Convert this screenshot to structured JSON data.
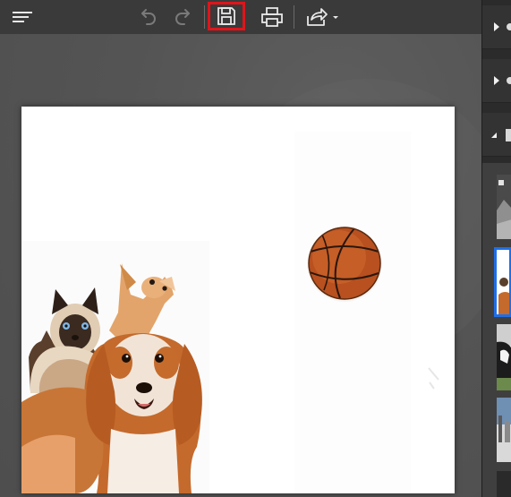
{
  "toolbar": {
    "menu_icon": "hamburger-menu-icon",
    "undo_icon": "undo-icon",
    "redo_icon": "redo-icon",
    "save_icon": "save-icon",
    "print_icon": "print-icon",
    "share_icon": "share-icon",
    "highlight_color": "#e0141b",
    "enabled_icon_color": "#e8e8e8",
    "disabled_icon_color": "#7a7a7a"
  },
  "canvas": {
    "background_color": "#535353",
    "document_color": "#ffffff",
    "layers": [
      {
        "content": "pets-photo",
        "subjects": [
          "siamese-cat",
          "chihuahua",
          "cocker-spaniel"
        ]
      },
      {
        "content": "basketball-photo"
      }
    ]
  },
  "side_panel": {
    "rows": [
      "collapsed",
      "collapsed",
      "expanded"
    ],
    "thumbnails": [
      {
        "content": "landscape-thumbnail",
        "selected": false
      },
      {
        "content": "pets-thumbnail",
        "selected": true
      },
      {
        "content": "cow-thumbnail",
        "selected": false
      },
      {
        "content": "street-thumbnail",
        "selected": false
      }
    ],
    "selection_color": "#1e6fe8"
  }
}
